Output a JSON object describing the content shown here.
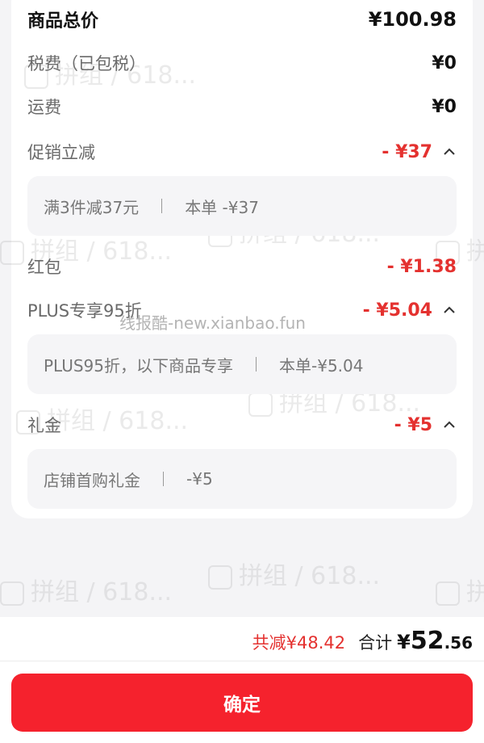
{
  "summary": {
    "total_label": "商品总价",
    "total_value": "¥100.98",
    "tax_label": "税费（已包税）",
    "tax_value": "¥0",
    "shipping_label": "运费",
    "shipping_value": "¥0"
  },
  "promo": {
    "label": "促销立减",
    "value": "- ¥37",
    "detail": "满3件减37元",
    "detail_amount": "本单 -¥37"
  },
  "red_packet": {
    "label": "红包",
    "value": "- ¥1.38"
  },
  "plus": {
    "label": "PLUS专享95折",
    "value": "- ¥5.04",
    "detail": "PLUS95折，以下商品专享",
    "detail_amount": "本单-¥5.04"
  },
  "gift": {
    "label": "礼金",
    "value": "- ¥5",
    "detail": "店铺首购礼金",
    "detail_amount": "-¥5"
  },
  "footer": {
    "saved": "共减¥48.42",
    "total_label": "合计",
    "total_currency": "¥",
    "total_integer": "52",
    "total_decimal": ".56",
    "confirm_label": "确定"
  },
  "watermark": {
    "text": "拼组 / 618...",
    "url": "线报酷-new.xianbao.fun"
  },
  "colors": {
    "accent_red": "#e4312f",
    "button_red": "#f5222d"
  }
}
